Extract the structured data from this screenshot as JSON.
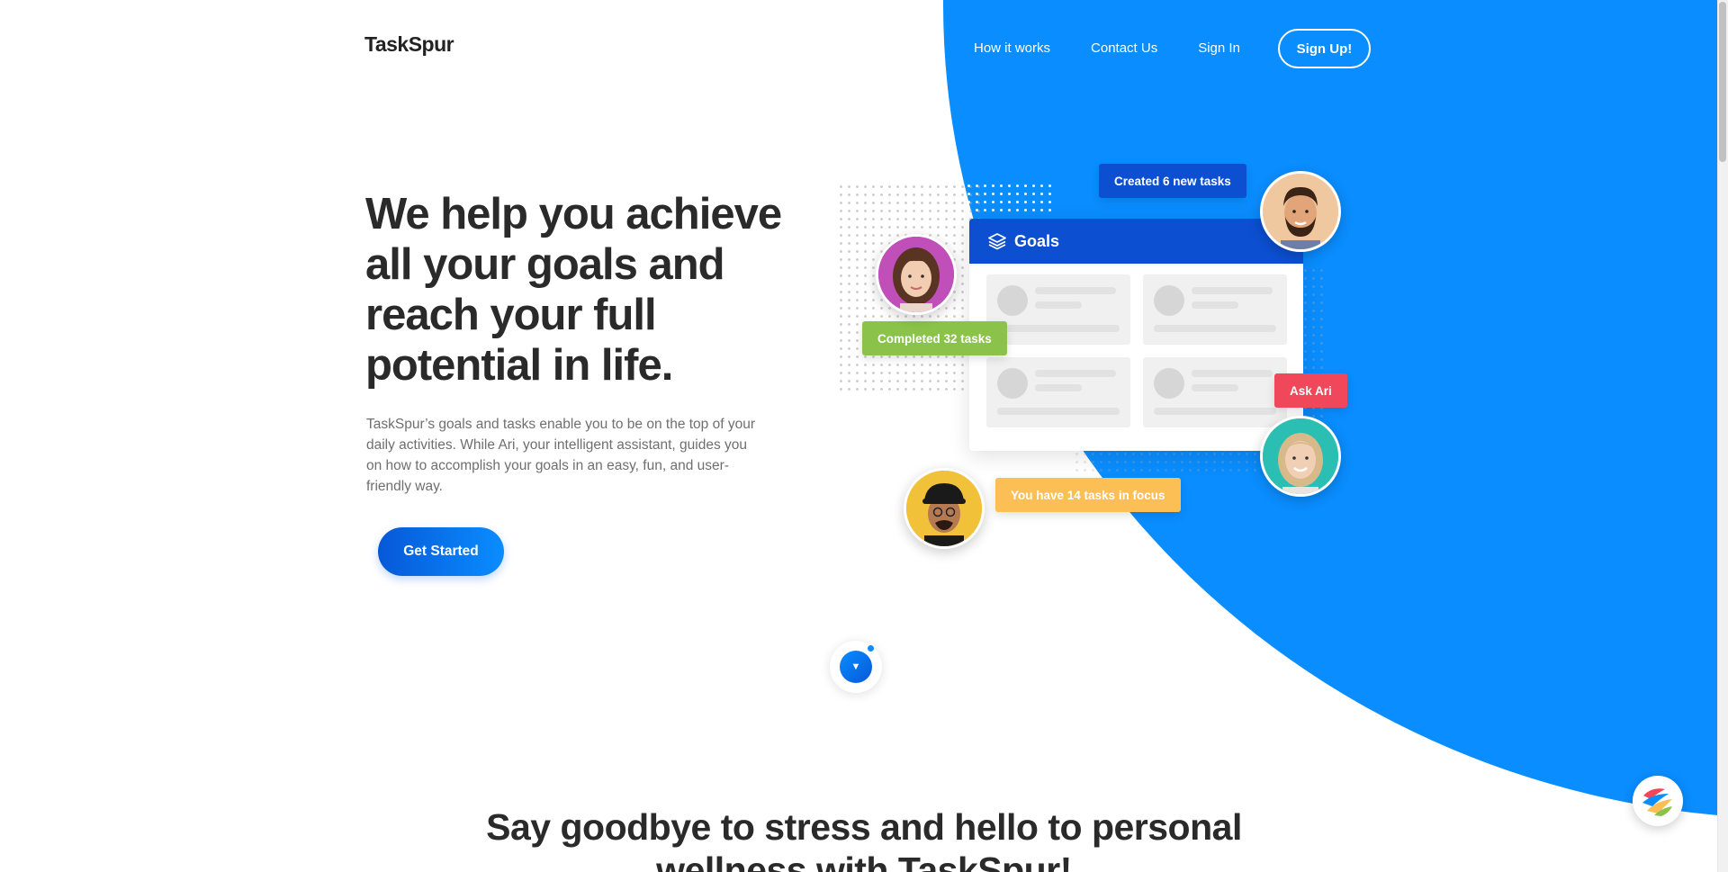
{
  "header": {
    "logo": "TaskSpur",
    "nav": [
      {
        "label": "How it works"
      },
      {
        "label": "Contact Us"
      },
      {
        "label": "Sign In"
      }
    ],
    "signup_label": "Sign Up!"
  },
  "hero": {
    "title": "We help you achieve all your goals and reach your full potential in life.",
    "description": "TaskSpur’s goals and tasks enable you to be on the top of your daily activities. While Ari, your intelligent assistant, guides you on how to accomplish your goals in an easy, fun, and user-friendly way.",
    "cta_label": "Get Started"
  },
  "illustration": {
    "card_title": "Goals",
    "tags": {
      "created": "Created 6 new tasks",
      "completed": "Completed 32 tasks",
      "ask": "Ask Ari",
      "focus": "You have 14 tasks in focus"
    },
    "colors": {
      "primary_blue": "#0a8dff",
      "dark_blue": "#0c4fd1",
      "green": "#8bc34a",
      "red": "#f0485a",
      "yellow": "#fbbf55"
    }
  },
  "section": {
    "title": "Say goodbye to stress and hello to personal wellness with TaskSpur!"
  }
}
